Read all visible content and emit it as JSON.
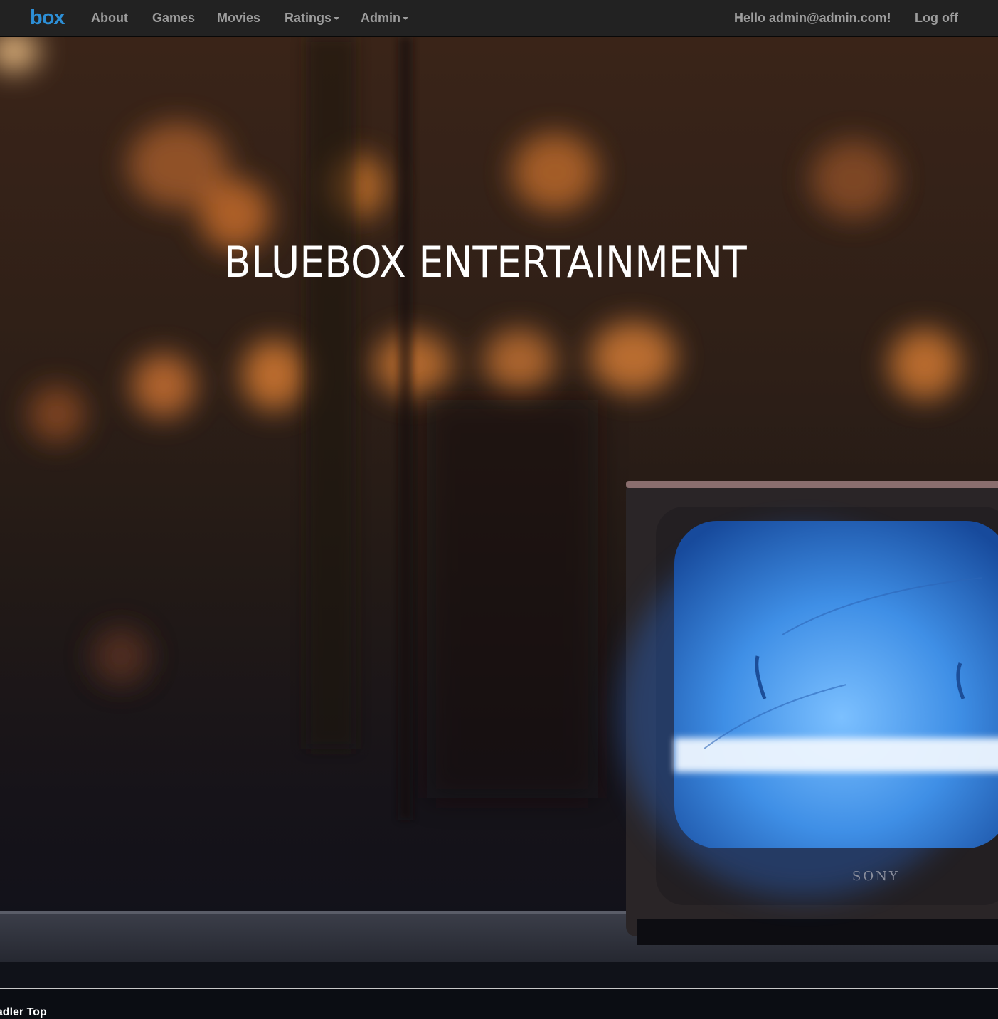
{
  "navbar": {
    "brand_text": "box",
    "brand_color": "#2d8fd6",
    "links": {
      "about": "About",
      "games": "Games",
      "movies": "Movies",
      "ratings": "Ratings",
      "admin": "Admin"
    },
    "greeting": "Hello admin@admin.com!",
    "logoff": "Log off"
  },
  "hero": {
    "title": "BLUEBOX ENTERTAINMENT",
    "tv_brand": "SONY",
    "screen_color": "#3f8fe6"
  },
  "footer": {
    "text": "Jadler Top"
  }
}
